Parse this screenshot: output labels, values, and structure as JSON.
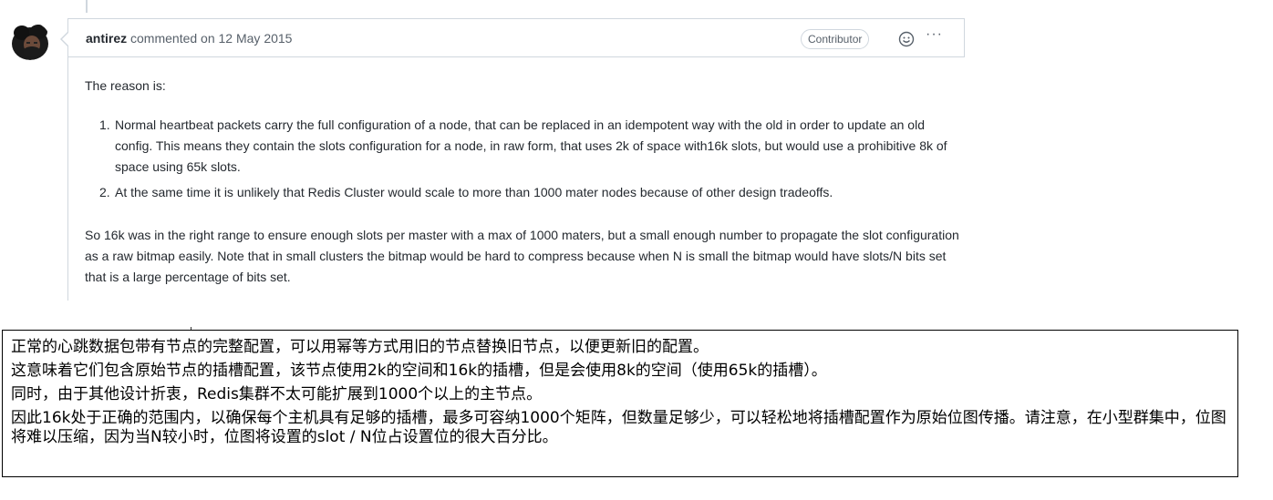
{
  "comment": {
    "author": "antirez",
    "action": "commented on",
    "date": "12 May 2015",
    "badge": "Contributor",
    "emoji_icon": "smiley-icon",
    "more_icon": "kebab-horizontal-icon",
    "more_label": "···",
    "intro": "The reason is:",
    "list": [
      {
        "num": "1.",
        "text": "Normal heartbeat packets carry the full configuration of a node, that can be replaced in an idempotent way with the old in order to update an old config. This means they contain the slots configuration for a node, in raw form, that uses 2k of space with16k slots, but would use a prohibitive 8k of space using 65k slots."
      },
      {
        "num": "2.",
        "text": "At the same time it is unlikely that Redis Cluster would scale to more than 1000 mater nodes because of other design tradeoffs."
      }
    ],
    "closing": "So 16k was in the right range to ensure enough slots per master with a max of 1000 maters, but a small enough number to propagate the slot configuration as a raw bitmap easily. Note that in small clusters the bitmap would be hard to compress because when N is small the bitmap would have slots/N bits set that is a large percentage of bits set."
  },
  "translation": {
    "lines": [
      "正常的心跳数据包带有节点的完整配置，可以用幂等方式用旧的节点替换旧节点，以便更新旧的配置。",
      "这意味着它们包含原始节点的插槽配置，该节点使用2k的空间和16k的插槽，但是会使用8k的空间（使用65k的插槽）。",
      "同时，由于其他设计折衷，Redis集群不太可能扩展到1000个以上的主节点。",
      "因此16k处于正确的范围内，以确保每个主机具有足够的插槽，最多可容纳1000个矩阵，但数量足够少，可以轻松地将插槽配置作为原始位图传播。请注意，在小型群集中，位图将难以压缩，因为当N较小时，位图将设置的slot / N位占设置位的很大百分比。"
    ]
  },
  "colors": {
    "border": "#d0d7de",
    "muted_text": "#57606a",
    "body_text": "#24292f"
  }
}
